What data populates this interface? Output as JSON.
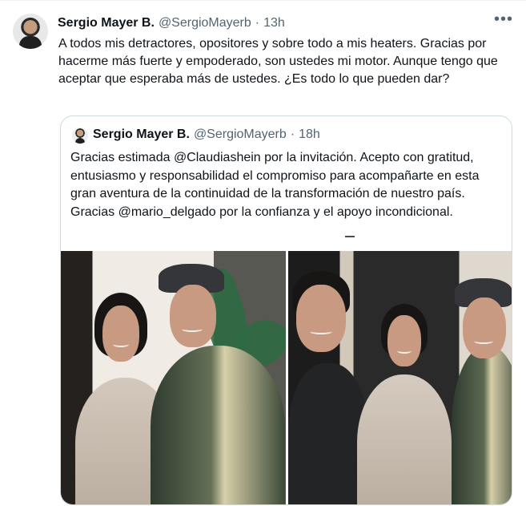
{
  "tweet": {
    "author_name": "Sergio Mayer B.",
    "author_handle": "@SergioMayerb",
    "separator": "·",
    "time": "13h",
    "menu_icon": "more-horizontal-icon",
    "text": "A todos mis detractores, opositores y sobre todo a mis heaters. Gracias por hacerme más fuerte y empoderado, son ustedes mi motor. Aunque tengo que aceptar que esperaba  más de ustedes. ¿Es todo lo que pueden dar?"
  },
  "quoted": {
    "author_name": "Sergio Mayer B.",
    "author_handle": "@SergioMayerb",
    "separator": "·",
    "time": "18h",
    "text": "Gracias estimada  @Claudiashein por la invitación. Acepto con gratitud, entusiasmo y responsabilidad el compromiso  para acompañarte en esta gran aventura de la continuidad de la transformación de nuestro país. Gracias @mario_delgado por la confianza y el apoyo incondicional."
  },
  "colors": {
    "text": "#0f1419",
    "secondary_text": "#536471",
    "border": "#cfd9de",
    "background": "#ffffff"
  }
}
